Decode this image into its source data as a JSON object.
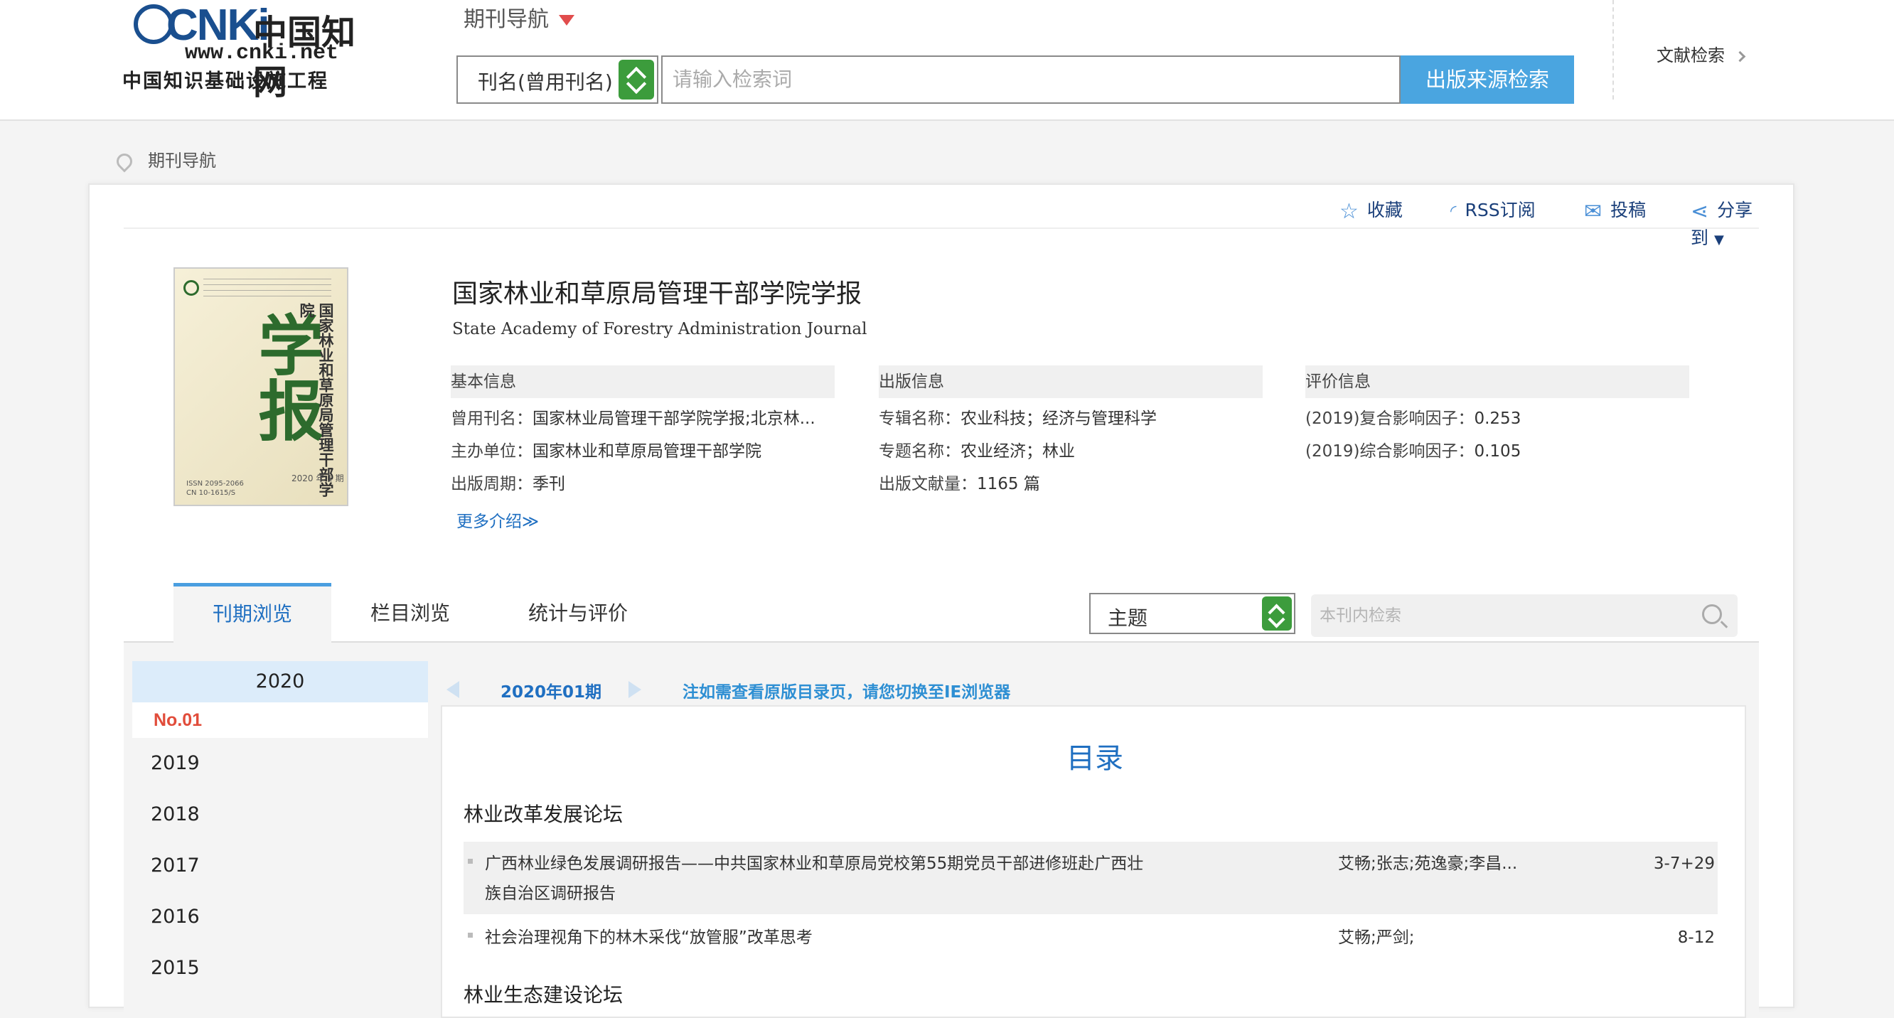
{
  "header": {
    "logo_wordmark": "CNKi",
    "logo_title": "中国知网",
    "logo_url": "www.cnki.net",
    "logo_subtitle": "中国知识基础设施工程",
    "nav_label": "期刊导航",
    "search_field_selected": "刊名(曾用刊名)",
    "search_placeholder": "请输入检索词",
    "search_button": "出版来源检索",
    "doc_search_link": "文献检索"
  },
  "breadcrumb": {
    "label": "期刊导航"
  },
  "actions": {
    "favorite": "收藏",
    "rss": "RSS订阅",
    "submit": "投稿",
    "share": "分享到"
  },
  "journal": {
    "title": "国家林业和草原局管理干部学院学报",
    "english_title": "State Academy of Forestry Administration Journal",
    "cover": {
      "big_chars": "学报",
      "vertical_title": "国家林业和草原局管理干部学院",
      "year": "2020 年 1 期",
      "issn": "ISSN 2095-2066\nCN 10-1615/S"
    },
    "more": "更多介绍≫"
  },
  "info": {
    "basic": {
      "header": "基本信息",
      "rows": [
        {
          "k": "曾用刊名：",
          "v": "国家林业局管理干部学院学报;北京林..."
        },
        {
          "k": "主办单位：",
          "v": "国家林业和草原局管理干部学院"
        },
        {
          "k": "出版周期：",
          "v": "季刊"
        }
      ]
    },
    "publish": {
      "header": "出版信息",
      "rows": [
        {
          "k": "专辑名称：",
          "v": "农业科技；经济与管理科学"
        },
        {
          "k": "专题名称：",
          "v": "农业经济；林业"
        },
        {
          "k": "出版文献量：",
          "v": "1165 篇"
        }
      ]
    },
    "eval": {
      "header": "评价信息",
      "rows": [
        {
          "k": "(2019)复合影响因子：",
          "v": "0.253"
        },
        {
          "k": "(2019)综合影响因子：",
          "v": "0.105"
        }
      ]
    }
  },
  "tabs": [
    "刊期浏览",
    "栏目浏览",
    "统计与评价"
  ],
  "in_search": {
    "field": "主题",
    "placeholder": "本刊内检索"
  },
  "years": {
    "current": "2020",
    "current_issue": "No.01",
    "others": [
      "2019",
      "2018",
      "2017",
      "2016",
      "2015"
    ]
  },
  "issue": {
    "label": "2020年01期",
    "ie_note": "注如需查看原版目录页，请您切换至IE浏览器"
  },
  "toc": {
    "title": "目录",
    "sections": [
      {
        "name": "林业改革发展论坛",
        "articles": [
          {
            "title": "广西林业绿色发展调研报告——中共国家林业和草原局党校第55期党员干部进修班赴广西壮族自治区调研报告",
            "authors": "艾畅;张志;苑逸豪;李昌...",
            "pages": "3-7+29"
          },
          {
            "title": "社会治理视角下的林木采伐“放管服”改革思考",
            "authors": "艾畅;严剑;",
            "pages": "8-12"
          }
        ]
      },
      {
        "name": "林业生态建设论坛",
        "articles": []
      }
    ]
  }
}
